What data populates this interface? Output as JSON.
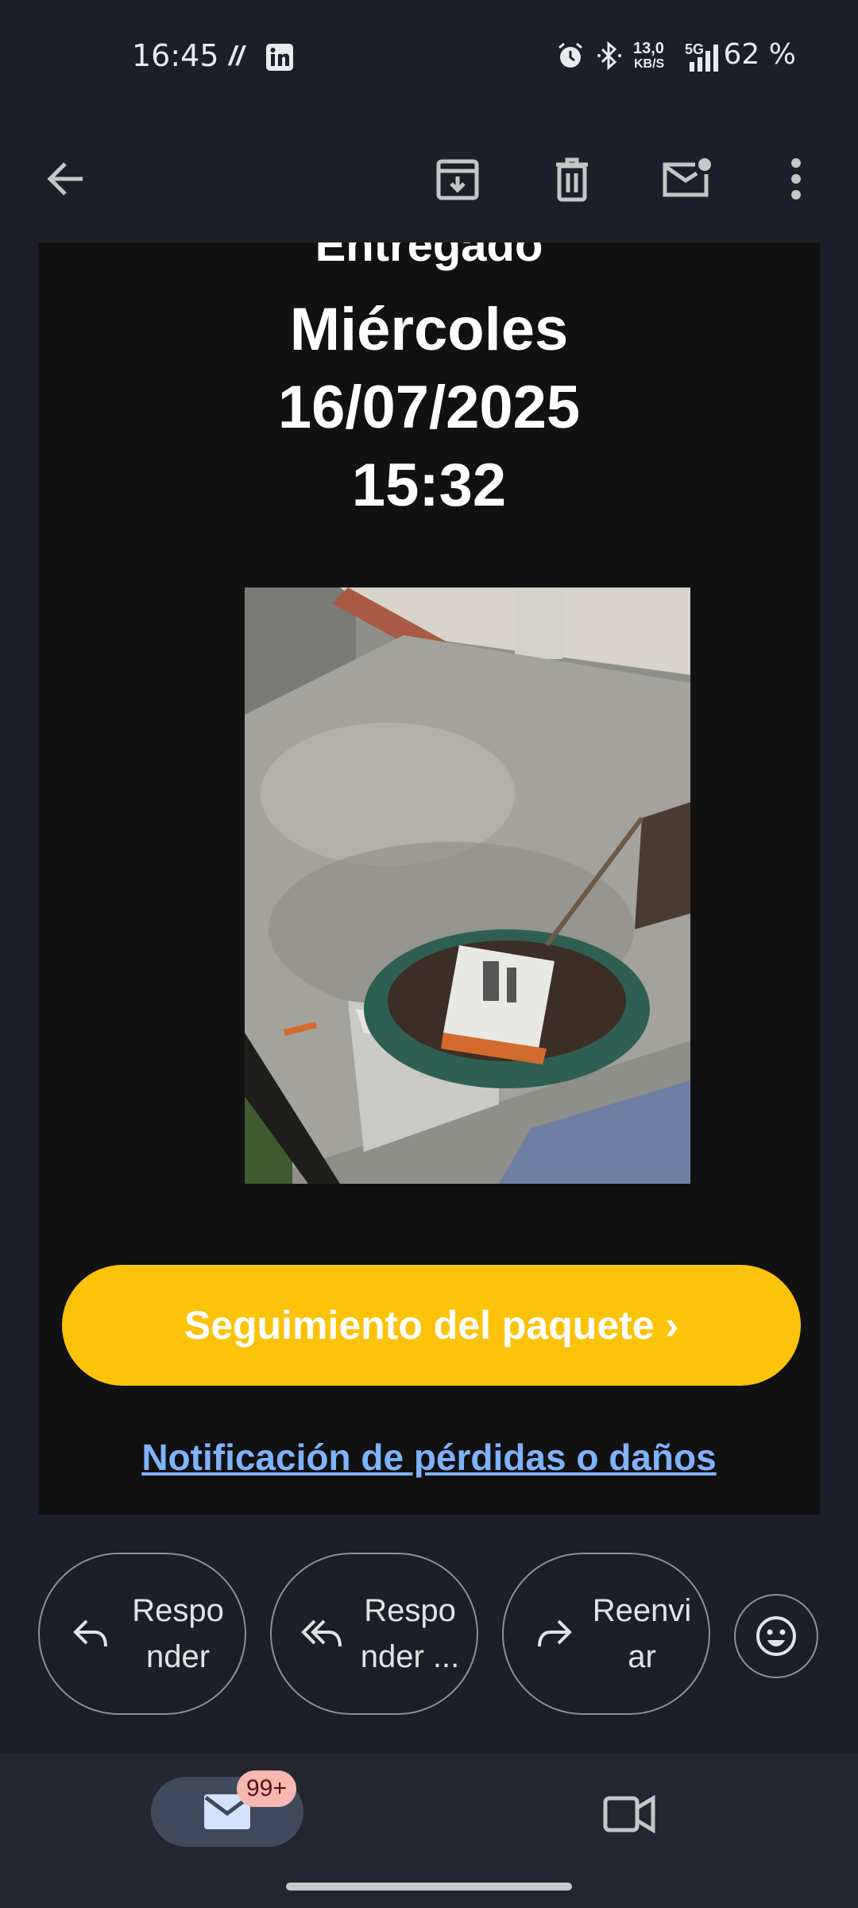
{
  "status_bar": {
    "time": "16:45",
    "net_speed_value": "13,0",
    "net_speed_unit": "KB/S",
    "network_type": "5G",
    "battery": "62 %"
  },
  "app_bar": {
    "icons": [
      "back-arrow-icon",
      "archive-icon",
      "trash-icon",
      "mark-unread-icon",
      "more-vert-icon"
    ]
  },
  "email": {
    "status_word": "Entregado",
    "day": "Miércoles",
    "date": "16/07/2025",
    "time": "15:32",
    "track_button": "Seguimiento del paquete ›",
    "loss_link": "Notificación de pérdidas o daños",
    "button_color": "#fcc30a",
    "link_color": "#7eb3ff"
  },
  "actions": {
    "reply": "Respo\nnder",
    "reply_all": "Respo\nnder ...",
    "forward": "Reenvi\nar"
  },
  "bottom_nav": {
    "mail_badge": "99+"
  }
}
